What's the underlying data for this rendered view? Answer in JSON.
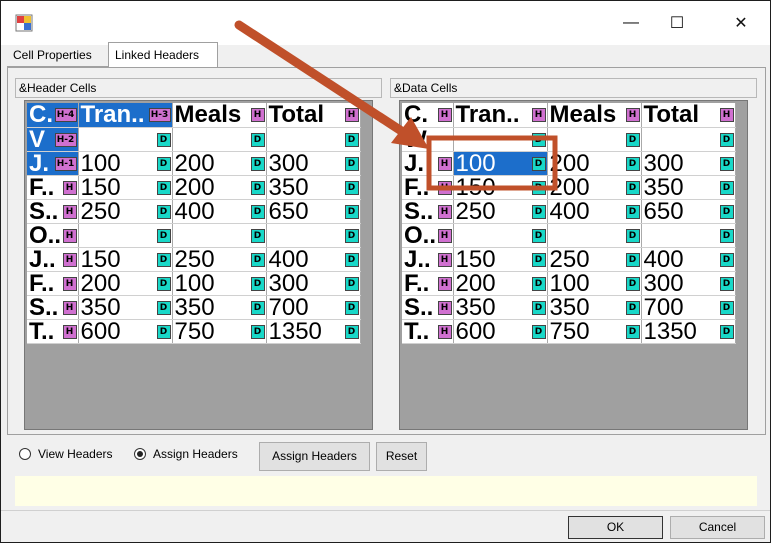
{
  "window": {
    "minimize_glyph": "—",
    "maximize_glyph": "☐",
    "close_glyph": "✕"
  },
  "tabs": [
    {
      "label": "Cell Properties"
    },
    {
      "label": "Linked Headers"
    }
  ],
  "left_group": {
    "label": "&Header Cells",
    "columns": [
      {
        "text": "C.",
        "badge": "H-4"
      },
      {
        "text": "Tran..",
        "badge": "H-3"
      },
      {
        "text": "Meals",
        "badge": "H"
      },
      {
        "text": "Total",
        "badge": "H"
      }
    ],
    "rows": [
      [
        {
          "text": "V",
          "badge": "H-2"
        },
        {
          "text": "",
          "badge": "D"
        },
        {
          "text": "",
          "badge": "D"
        },
        {
          "text": "",
          "badge": "D"
        }
      ],
      [
        {
          "text": "J.",
          "badge": "H-1"
        },
        {
          "text": "100",
          "badge": "D"
        },
        {
          "text": "200",
          "badge": "D"
        },
        {
          "text": "300",
          "badge": "D"
        }
      ],
      [
        {
          "text": "F..",
          "badge": "H"
        },
        {
          "text": "150",
          "badge": "D"
        },
        {
          "text": "200",
          "badge": "D"
        },
        {
          "text": "350",
          "badge": "D"
        }
      ],
      [
        {
          "text": "S..",
          "badge": "H"
        },
        {
          "text": "250",
          "badge": "D"
        },
        {
          "text": "400",
          "badge": "D"
        },
        {
          "text": "650",
          "badge": "D"
        }
      ],
      [
        {
          "text": "O..",
          "badge": "H"
        },
        {
          "text": "",
          "badge": "D"
        },
        {
          "text": "",
          "badge": "D"
        },
        {
          "text": "",
          "badge": "D"
        }
      ],
      [
        {
          "text": "J..",
          "badge": "H"
        },
        {
          "text": "150",
          "badge": "D"
        },
        {
          "text": "250",
          "badge": "D"
        },
        {
          "text": "400",
          "badge": "D"
        }
      ],
      [
        {
          "text": "F..",
          "badge": "H"
        },
        {
          "text": "200",
          "badge": "D"
        },
        {
          "text": "100",
          "badge": "D"
        },
        {
          "text": "300",
          "badge": "D"
        }
      ],
      [
        {
          "text": "S..",
          "badge": "H"
        },
        {
          "text": "350",
          "badge": "D"
        },
        {
          "text": "350",
          "badge": "D"
        },
        {
          "text": "700",
          "badge": "D"
        }
      ],
      [
        {
          "text": "T..",
          "badge": "H"
        },
        {
          "text": "600",
          "badge": "D"
        },
        {
          "text": "750",
          "badge": "D"
        },
        {
          "text": "1350",
          "badge": "D"
        }
      ]
    ]
  },
  "right_group": {
    "label": "&Data Cells",
    "columns": [
      {
        "text": "C.",
        "badge": "H"
      },
      {
        "text": "Tran..",
        "badge": "H"
      },
      {
        "text": "Meals",
        "badge": "H"
      },
      {
        "text": "Total",
        "badge": "H"
      }
    ],
    "rows": [
      [
        {
          "text": "W",
          "badge": ""
        },
        {
          "text": "",
          "badge": "D"
        },
        {
          "text": "",
          "badge": "D"
        },
        {
          "text": "",
          "badge": "D"
        }
      ],
      [
        {
          "text": "J.",
          "badge": "H"
        },
        {
          "text": "100",
          "badge": "D"
        },
        {
          "text": "200",
          "badge": "D"
        },
        {
          "text": "300",
          "badge": "D"
        }
      ],
      [
        {
          "text": "F..",
          "badge": "H"
        },
        {
          "text": "150",
          "badge": "D"
        },
        {
          "text": "200",
          "badge": "D"
        },
        {
          "text": "350",
          "badge": "D"
        }
      ],
      [
        {
          "text": "S..",
          "badge": "H"
        },
        {
          "text": "250",
          "badge": "D"
        },
        {
          "text": "400",
          "badge": "D"
        },
        {
          "text": "650",
          "badge": "D"
        }
      ],
      [
        {
          "text": "O..",
          "badge": "H"
        },
        {
          "text": "",
          "badge": "D"
        },
        {
          "text": "",
          "badge": "D"
        },
        {
          "text": "",
          "badge": "D"
        }
      ],
      [
        {
          "text": "J..",
          "badge": "H"
        },
        {
          "text": "150",
          "badge": "D"
        },
        {
          "text": "250",
          "badge": "D"
        },
        {
          "text": "400",
          "badge": "D"
        }
      ],
      [
        {
          "text": "F..",
          "badge": "H"
        },
        {
          "text": "200",
          "badge": "D"
        },
        {
          "text": "100",
          "badge": "D"
        },
        {
          "text": "300",
          "badge": "D"
        }
      ],
      [
        {
          "text": "S..",
          "badge": "H"
        },
        {
          "text": "350",
          "badge": "D"
        },
        {
          "text": "350",
          "badge": "D"
        },
        {
          "text": "700",
          "badge": "D"
        }
      ],
      [
        {
          "text": "T..",
          "badge": "H"
        },
        {
          "text": "600",
          "badge": "D"
        },
        {
          "text": "750",
          "badge": "D"
        },
        {
          "text": "1350",
          "badge": "D"
        }
      ]
    ]
  },
  "radios": {
    "view_label": "View Headers",
    "assign_label": "Assign Headers",
    "selected": "assign"
  },
  "buttons": {
    "assign_headers": "Assign Headers",
    "reset": "Reset",
    "ok": "OK",
    "cancel": "Cancel"
  },
  "colors": {
    "selection": "#1c6ecb",
    "header_badge": "#d070d0",
    "data_badge": "#18d8c8",
    "annotation": "#c0502a"
  }
}
